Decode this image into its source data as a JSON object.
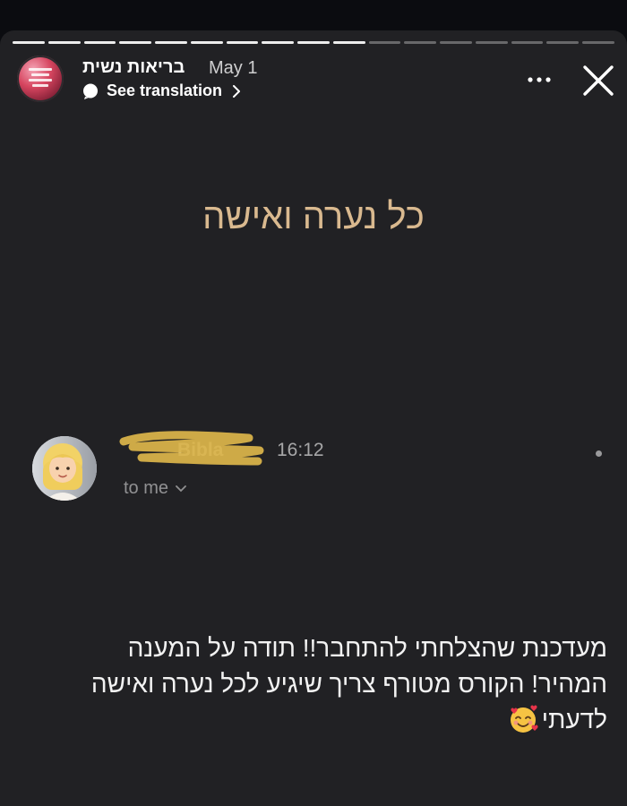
{
  "story": {
    "progress": {
      "total_segments": 17,
      "seen_segments": 10
    },
    "header": {
      "account_name": "בריאות נשית",
      "date": "May 1",
      "see_translation": "See translation"
    },
    "headline": "כל נערה ואישה",
    "email": {
      "sender_visible": "Bibla",
      "time": "16:12",
      "recipient": "to me"
    },
    "message_lines": [
      "מעדכנת שהצלחתי להתחבר!! תודה על המענה",
      "המהיר! הקורס מטורף צריך שיגיע לכל נערה ואישה",
      "לדעתי"
    ]
  },
  "colors": {
    "background": "#0b0c10",
    "story_card": "#212124",
    "headline": "#d9b98f",
    "redaction": "#d8b24a"
  },
  "icons": [
    "more-options-icon",
    "close-icon",
    "translate-bubble-icon",
    "chevron-right-icon",
    "chevron-down-icon",
    "smiling-face-with-hearts-icon"
  ]
}
